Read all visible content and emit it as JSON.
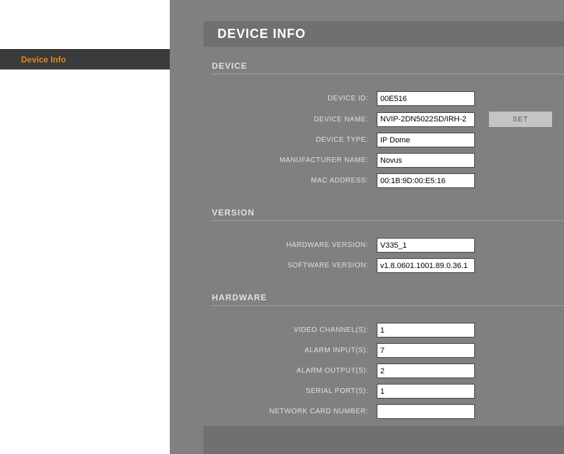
{
  "sidebar": {
    "activeItem": "Device Info"
  },
  "page": {
    "title": "DEVICE INFO"
  },
  "sections": {
    "device": {
      "header": "DEVICE",
      "fields": {
        "deviceId": {
          "label": "DEVICE ID:",
          "value": "00E516"
        },
        "deviceName": {
          "label": "DEVICE NAME:",
          "value": "NVIP-2DN5022SD/IRH-2"
        },
        "deviceType": {
          "label": "DEVICE TYPE:",
          "value": "IP Dome"
        },
        "manufacturerName": {
          "label": "MANUFACTURER NAME:",
          "value": "Novus"
        },
        "macAddress": {
          "label": "MAC ADDRESS:",
          "value": "00:1B:9D:00:E5:16"
        }
      },
      "setButton": "SET"
    },
    "version": {
      "header": "VERSION",
      "fields": {
        "hardwareVersion": {
          "label": "HARDWARE VERSION:",
          "value": "V335_1"
        },
        "softwareVersion": {
          "label": "SOFTWARE VERSION:",
          "value": "v1.8.0601.1001.89.0.36.1"
        }
      }
    },
    "hardware": {
      "header": "HARDWARE",
      "fields": {
        "videoChannels": {
          "label": "VIDEO CHANNEL(S):",
          "value": "1"
        },
        "alarmInputs": {
          "label": "ALARM INPUT(S):",
          "value": "7"
        },
        "alarmOutputs": {
          "label": "ALARM OUTPUT(S):",
          "value": "2"
        },
        "serialPorts": {
          "label": "SERIAL PORT(S):",
          "value": "1"
        },
        "networkCardNumber": {
          "label": "NETWORK CARD NUMBER:",
          "value": ""
        }
      }
    }
  }
}
